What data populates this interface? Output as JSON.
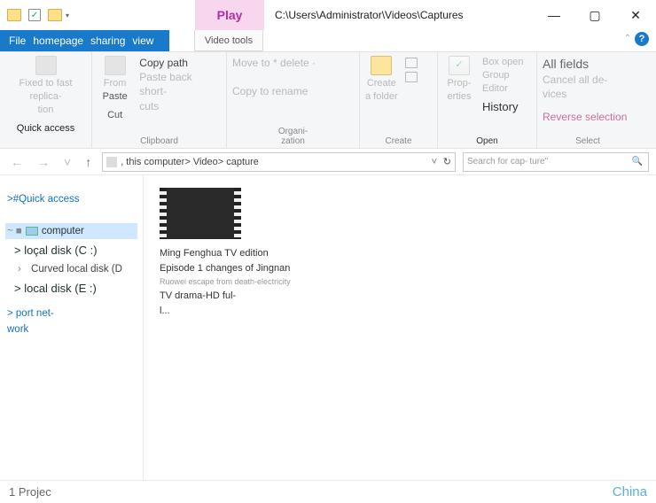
{
  "titlebar": {
    "play_label": "Play",
    "video_tools_label": "Video tools",
    "path": "C:\\Users\\Administrator\\Videos\\Captures"
  },
  "tabs": {
    "file": "File",
    "homepage": "homepage",
    "sharing": "sharing",
    "view": "view"
  },
  "ribbon": {
    "pin_label1": "Fixed to fast replica-",
    "pin_label2": "tion",
    "quick_access": "Quick access",
    "from": "From",
    "paste": "Paste",
    "cut": "Cut",
    "copy_path": "Copy path",
    "paste_shortcut1": "Paste back short-",
    "paste_shortcut2": "cuts",
    "clipboard": "Clipboard",
    "move_delete": "Move to * delete ·",
    "copy_rename": "Copy to rename",
    "organization1": "Organi-",
    "organization2": "zation",
    "create_folder1": "Create",
    "create_folder2": "a folder",
    "create": "Create",
    "properties1": "Prop-",
    "properties2": "erties",
    "box_open": "Box open",
    "group_editor1": "Group",
    "group_editor2": "Editor",
    "history": "History",
    "open": "Open",
    "all_fields": "All fields",
    "cancel_devices1": "Cancel all de-",
    "cancel_devices2": "vices",
    "reverse_selection": "Reverse selection",
    "select": "Select"
  },
  "nav": {
    "breadcrumb": ", this computer> Video> capture",
    "search_placeholder1": "Search for cap-",
    "search_placeholder2": "ture\""
  },
  "sidebar": {
    "quick_access": ">#Quick access",
    "computer_prefix": "~ ■",
    "computer": "computer",
    "local_c": "> loçal disk (C :)",
    "curved_d": "Curved local disk (D",
    "local_e": "> local disk (E :)",
    "port1": "> port net-",
    "port2": "work"
  },
  "item": {
    "line1": "Ming Fenghua TV edition",
    "line2": "Episode 1 changes of Jingnan",
    "line3": "Ruowei escape from death-electricity",
    "line4": "TV drama-HD ful-",
    "line5": "l..."
  },
  "status": {
    "count": "1 Projec",
    "lang": "China"
  }
}
